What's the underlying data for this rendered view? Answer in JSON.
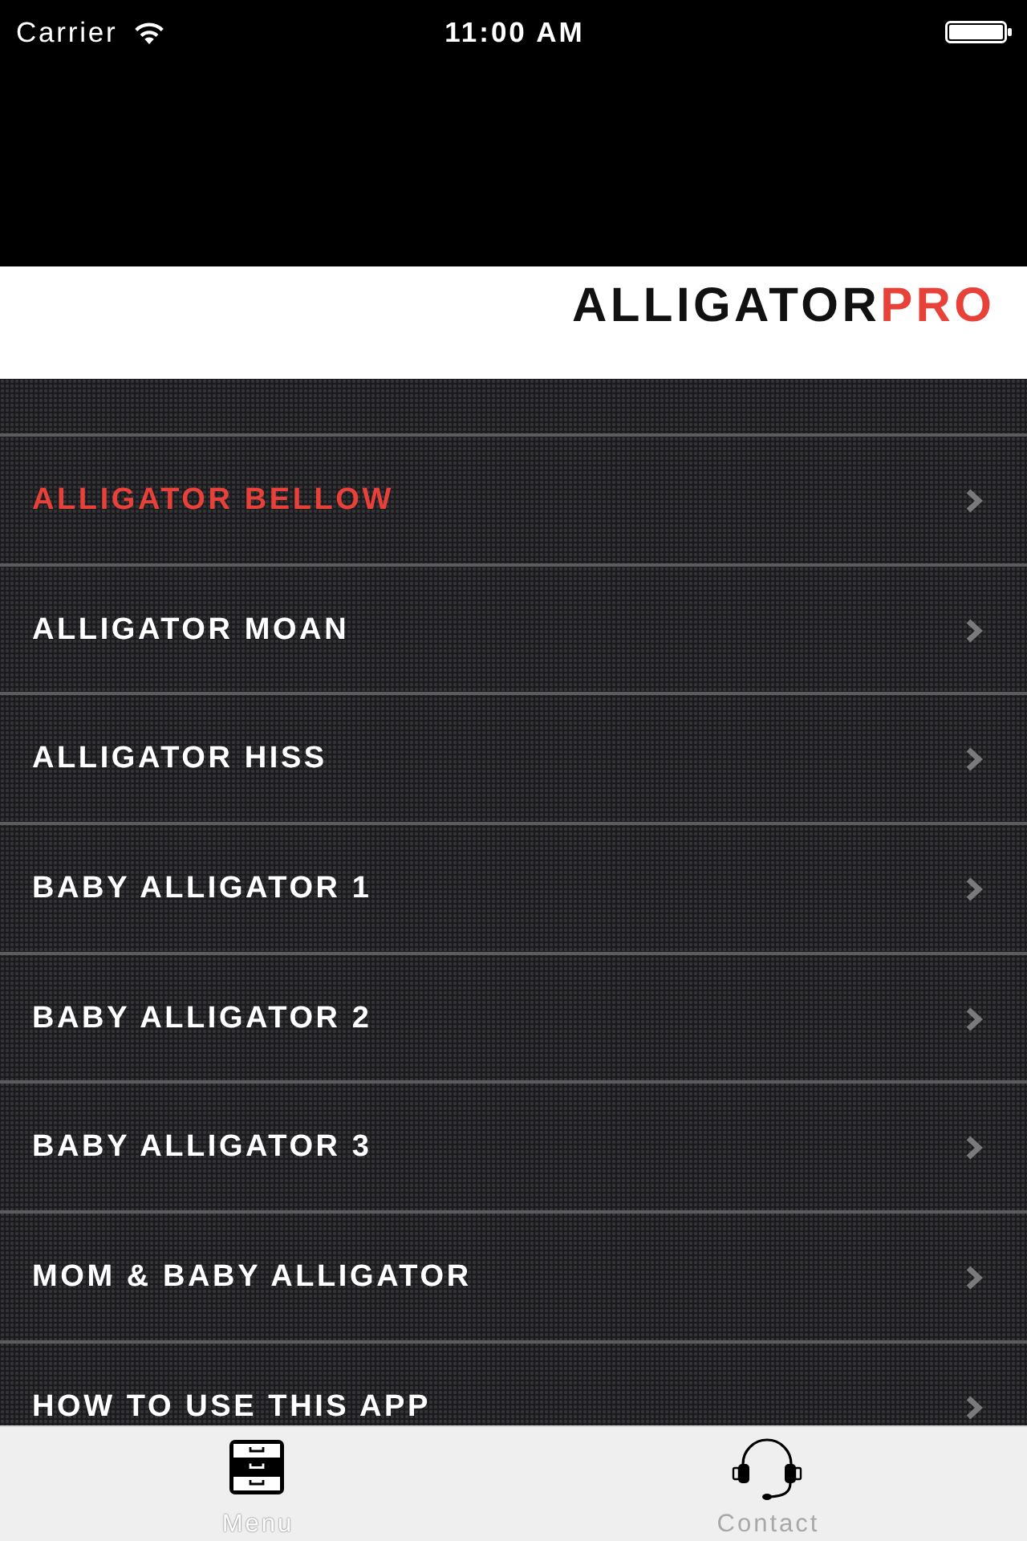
{
  "status_bar": {
    "carrier": "Carrier",
    "time": "11:00 AM"
  },
  "header": {
    "logo": {
      "main": "ALLIGATOR",
      "accent": "PRO"
    }
  },
  "menu_items": [
    {
      "label": "ALLIGATOR BELLOW",
      "selected": true
    },
    {
      "label": "ALLIGATOR MOAN",
      "selected": false
    },
    {
      "label": "ALLIGATOR HISS",
      "selected": false
    },
    {
      "label": "BABY ALLIGATOR 1",
      "selected": false
    },
    {
      "label": "BABY ALLIGATOR 2",
      "selected": false
    },
    {
      "label": "BABY ALLIGATOR 3",
      "selected": false
    },
    {
      "label": "MOM & BABY ALLIGATOR",
      "selected": false
    },
    {
      "label": "HOW TO USE THIS APP",
      "selected": false
    }
  ],
  "tab_bar": {
    "tabs": [
      {
        "kind": "menu",
        "label": "Menu",
        "selected": true
      },
      {
        "kind": "contact",
        "label": "Contact",
        "selected": false
      }
    ]
  }
}
